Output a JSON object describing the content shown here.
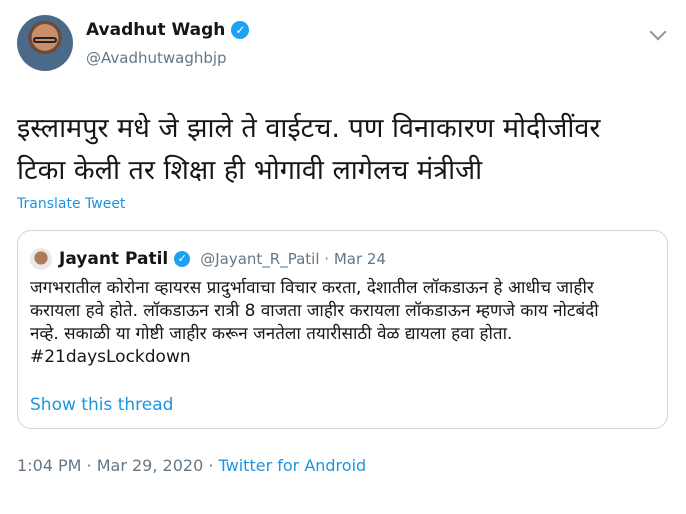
{
  "author": {
    "name": "Avadhut Wagh",
    "handle": "@Avadhutwaghbjp"
  },
  "tweet": {
    "text": "इस्लामपुर मधे जे झाले ते वाईटच. पण विनाकारण मोदीजींवर\nटिका केली तर शिक्षा ही भोगावी लागेलच मंत्रीजी",
    "translate_label": "Translate Tweet"
  },
  "quoted": {
    "name": "Jayant Patil",
    "handle_date": "@Jayant_R_Patil · Mar 24",
    "text": "जगभरातील कोरोना व्हायरस  प्रादुर्भावाचा विचार करता, देशातील लॉकडाऊन हे आधीच जाहीर\nकरायला हवे होते. लॉकडाऊन रात्री 8 वाजता जाहीर करायला लॉकडाऊन म्हणजे काय नोटबंदी\nनव्हे. सकाळी या गोष्टी जाहीर करून जनतेला तयारीसाठी वेळ द्यायला हवा होता.\n#21daysLockdown",
    "show_thread_label": "Show this thread"
  },
  "meta": {
    "timestamp": "1:04 PM · Mar 29, 2020 · ",
    "source": "Twitter for Android"
  },
  "icons": {
    "verified": "verified-badge-icon",
    "chevron": "chevron-down-icon"
  },
  "colors": {
    "accent": "#1da1f2",
    "link": "#1b95e0",
    "secondary_text": "#657786",
    "border": "#ccd6dd"
  }
}
